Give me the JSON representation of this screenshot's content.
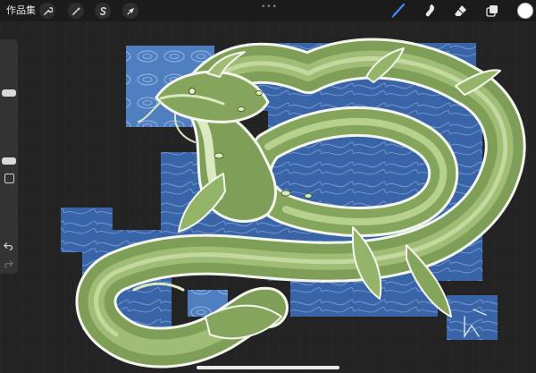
{
  "toolbar": {
    "gallery_label": "作品集",
    "more_dots": "•••"
  },
  "icons": {
    "actions": "wrench-icon",
    "adjustments": "magic-wand-icon",
    "selection": "selection-s-icon",
    "transform": "arrow-cursor-icon",
    "brush": "brush-icon",
    "smudge": "smudge-icon",
    "eraser": "eraser-icon",
    "layers": "layers-icon"
  },
  "colors": {
    "active_tool": "#3f8cff",
    "current_color": "#ffffff",
    "canvas_bg": "#232323",
    "ocean": "#3a64a8",
    "dragon_green": "#7f9e57",
    "dragon_light": "#c9dca6"
  }
}
